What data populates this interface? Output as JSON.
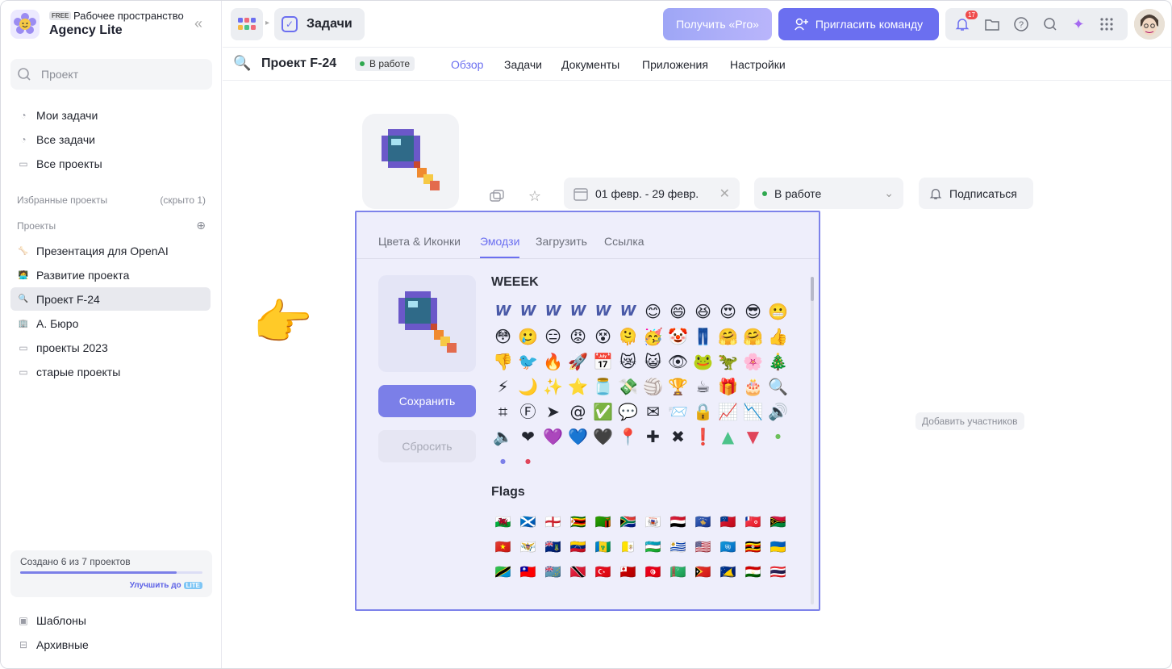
{
  "workspace": {
    "plan": "FREE",
    "label": "Рабочее пространство",
    "title": "Agency Lite"
  },
  "sidebar": {
    "search_placeholder": "Проект",
    "items": [
      {
        "label": "Мои задачи"
      },
      {
        "label": "Все задачи"
      },
      {
        "label": "Все проекты"
      }
    ],
    "favorites_title": "Избранные проекты",
    "favorites_hidden": "(скрыто 1)",
    "projects_title": "Проекты",
    "projects": [
      {
        "label": "Презентация для OpenAI",
        "icon": "🦴"
      },
      {
        "label": "Развитие проекта",
        "icon": "🧑‍💻"
      },
      {
        "label": "Проект F-24",
        "icon": "🔍",
        "active": true
      },
      {
        "label": "А. Бюро",
        "icon": "🏢"
      },
      {
        "label": "проекты 2023",
        "icon": "folder"
      },
      {
        "label": "старые проекты",
        "icon": "folder"
      }
    ],
    "quota_text": "Создано 6 из 7 проектов",
    "quota_fraction": 0.86,
    "upgrade_label": "Улучшить до",
    "upgrade_plan": "LITE",
    "bottom": [
      {
        "label": "Шаблоны"
      },
      {
        "label": "Архивные"
      }
    ]
  },
  "topbar": {
    "section": "Задачи",
    "pro_label": "Получить «Pro»",
    "invite_label": "Пригласить команду",
    "notifications": "17"
  },
  "project": {
    "title": "Проект F-24",
    "status": "В работе",
    "tabs": [
      {
        "label": "Обзор",
        "active": true
      },
      {
        "label": "Задачи"
      },
      {
        "label": "Документы"
      },
      {
        "label": "Приложения"
      },
      {
        "label": "Настройки"
      }
    ],
    "dates": "01 февр. - 29 февр.",
    "status_select": "В работе",
    "subscribe": "Подписаться",
    "add_participants": "Добавить участников"
  },
  "picker": {
    "tabs": [
      {
        "label": "Цвета & Иконки"
      },
      {
        "label": "Эмодзи",
        "active": true
      },
      {
        "label": "Загрузить"
      },
      {
        "label": "Ссылка"
      }
    ],
    "save_label": "Сохранить",
    "reset_label": "Сбросить",
    "section1": "WEEEK",
    "section2": "Flags",
    "emoji": [
      "W",
      "W",
      "W",
      "W",
      "W",
      "W",
      "😊",
      "😄",
      "😆",
      "😍",
      "😎",
      "😬",
      "😳",
      "🥲",
      "😑",
      "😡",
      "😵",
      "🫠",
      "🥳",
      "🤡",
      "👖",
      "🤗",
      "🤗",
      "👍",
      "👎",
      "🐦",
      "🔥",
      "🚀",
      "📅",
      "😿",
      "😺",
      "👁",
      "🐸",
      "🦖",
      "🌸",
      "🎄",
      "⚡",
      "🌙",
      "✨",
      "⭐",
      "🫙",
      "💸",
      "🏐",
      "🏆",
      "☕",
      "🎁",
      "🎂",
      "🔍",
      "⌗",
      "Ⓕ",
      "➤",
      "@",
      "✅",
      "💬",
      "✉",
      "📨",
      "🔒",
      "📈",
      "📉",
      "🔊",
      "🔈",
      "❤",
      "💜",
      "💙",
      "🖤",
      "📍",
      "✚",
      "✖",
      "❗",
      "▲",
      "▼",
      "●",
      "●",
      "●"
    ],
    "flags": [
      "🏴󠁧󠁢󠁷󠁬󠁳󠁿",
      "🏴󠁧󠁢󠁳󠁣󠁴󠁿",
      "🏴󠁧󠁢󠁥󠁮󠁧󠁿",
      "🇿🇼",
      "🇿🇲",
      "🇿🇦",
      "🇾🇹",
      "🇾🇪",
      "🇽🇰",
      "🇼🇸",
      "🇼🇫",
      "🇻🇺",
      "🇻🇳",
      "🇻🇮",
      "🇻🇬",
      "🇻🇪",
      "🇻🇨",
      "🇻🇦",
      "🇺🇿",
      "🇺🇾",
      "🇺🇸",
      "🇺🇳",
      "🇺🇬",
      "🇺🇦",
      "🇹🇿",
      "🇹🇼",
      "🇹🇻",
      "🇹🇹",
      "🇹🇷",
      "🇹🇴",
      "🇹🇳",
      "🇹🇲",
      "🇹🇱",
      "🇹🇰",
      "🇹🇯",
      "🇹🇭"
    ]
  }
}
